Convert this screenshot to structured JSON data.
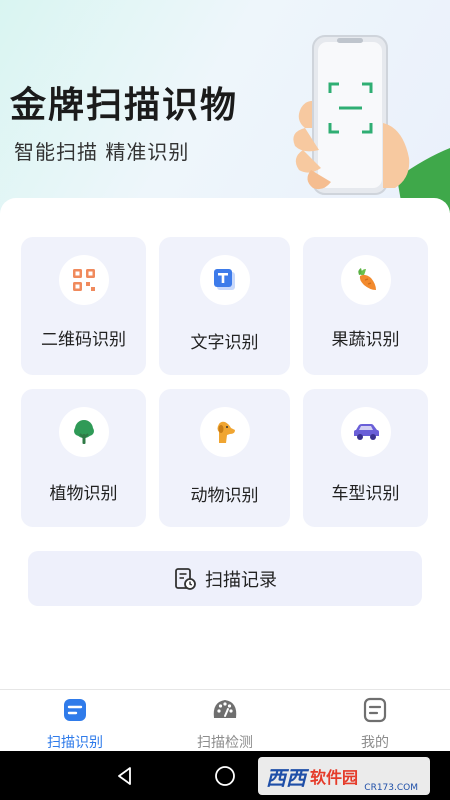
{
  "status_bar": {
    "left": "",
    "right": ""
  },
  "hero": {
    "title": "金牌扫描识物",
    "subtitle": "智能扫描 精准识别"
  },
  "tiles": [
    {
      "label": "二维码识别",
      "icon": "qr-code-icon"
    },
    {
      "label": "文字识别",
      "icon": "text-t-icon"
    },
    {
      "label": "果蔬识别",
      "icon": "carrot-icon"
    },
    {
      "label": "植物识别",
      "icon": "tree-icon"
    },
    {
      "label": "动物识别",
      "icon": "dog-icon"
    },
    {
      "label": "车型识别",
      "icon": "car-icon"
    }
  ],
  "record_button": {
    "label": "扫描记录",
    "icon": "record-icon"
  },
  "tabbar": {
    "items": [
      {
        "label": "扫描识别",
        "active": true,
        "icon": "scan-tab-icon"
      },
      {
        "label": "扫描检测",
        "active": false,
        "icon": "gauge-icon"
      },
      {
        "label": "我的",
        "active": false,
        "icon": "profile-icon"
      }
    ]
  },
  "watermark": {
    "brand": "西西",
    "text": "软件园",
    "url": "CR173.COM"
  },
  "colors": {
    "accent": "#2f7bea",
    "inactive": "#8c8c8c",
    "tile_bg": "#f0f2fb"
  }
}
